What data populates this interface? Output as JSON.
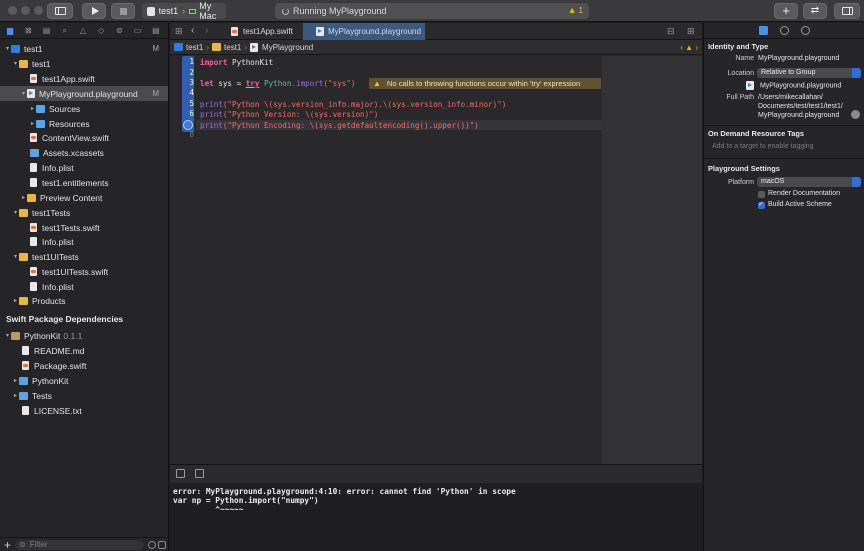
{
  "toolbar": {
    "scheme_target": "test1",
    "scheme_device": "My Mac",
    "activity_status": "Running MyPlayground",
    "warning_count": "1",
    "add_label": "+",
    "review_label": "⇄"
  },
  "navigator": {
    "tree": [
      {
        "label": "test1",
        "icon": "project-icon",
        "badge": "M",
        "disc": "▾"
      },
      {
        "label": "test1",
        "icon": "folder-icon",
        "badge": "",
        "disc": "▾"
      },
      {
        "label": "test1App.swift",
        "icon": "swift-file-icon",
        "badge": "",
        "disc": ""
      },
      {
        "label": "MyPlayground.playground",
        "icon": "playground-icon",
        "badge": "M",
        "disc": "▾",
        "selected": true
      },
      {
        "label": "Sources",
        "icon": "folder-icon",
        "badge": "",
        "disc": "▸"
      },
      {
        "label": "Resources",
        "icon": "folder-icon",
        "badge": "",
        "disc": "▸"
      },
      {
        "label": "ContentView.swift",
        "icon": "swift-file-icon",
        "badge": "",
        "disc": ""
      },
      {
        "label": "Assets.xcassets",
        "icon": "assets-icon",
        "badge": "",
        "disc": ""
      },
      {
        "label": "Info.plist",
        "icon": "plist-icon",
        "badge": "",
        "disc": ""
      },
      {
        "label": "test1.entitlements",
        "icon": "entitlements-icon",
        "badge": "",
        "disc": ""
      },
      {
        "label": "Preview Content",
        "icon": "folder-icon",
        "badge": "",
        "disc": "▸"
      },
      {
        "label": "test1Tests",
        "icon": "folder-icon",
        "badge": "",
        "disc": "▾"
      },
      {
        "label": "test1Tests.swift",
        "icon": "swift-file-icon",
        "badge": "",
        "disc": ""
      },
      {
        "label": "Info.plist",
        "icon": "plist-icon",
        "badge": "",
        "disc": ""
      },
      {
        "label": "test1UITests",
        "icon": "folder-icon",
        "badge": "",
        "disc": "▾"
      },
      {
        "label": "test1UITests.swift",
        "icon": "swift-file-icon",
        "badge": "",
        "disc": ""
      },
      {
        "label": "Info.plist",
        "icon": "plist-icon",
        "badge": "",
        "disc": ""
      },
      {
        "label": "Products",
        "icon": "folder-icon",
        "badge": "",
        "disc": "▸"
      }
    ],
    "section_header": "Swift Package Dependencies",
    "packages": [
      {
        "label": "PythonKit",
        "version": "0.1.1",
        "icon": "package-icon",
        "disc": "▾"
      },
      {
        "label": "README.md",
        "icon": "doc-icon",
        "disc": ""
      },
      {
        "label": "Package.swift",
        "icon": "swift-file-icon",
        "disc": ""
      },
      {
        "label": "PythonKit",
        "icon": "folder-icon",
        "disc": "▸"
      },
      {
        "label": "Tests",
        "icon": "folder-icon",
        "disc": "▸"
      },
      {
        "label": "LICENSE.txt",
        "icon": "doc-icon",
        "disc": ""
      }
    ],
    "filter_placeholder": "Filter"
  },
  "editor": {
    "tabs": [
      {
        "label": "test1App.swift",
        "active": false
      },
      {
        "label": "MyPlayground.playground",
        "active": true
      }
    ],
    "breadcrumb": [
      "test1",
      "test1",
      "MyPlayground"
    ],
    "line_numbers": [
      "1",
      "2",
      "3",
      "4",
      "5",
      "6",
      "7",
      "8"
    ],
    "code": {
      "line1_kw": "import",
      "line1_rest": " PythonKit",
      "line3_kw1": "let",
      "line3_mid": " sys = ",
      "line3_kw2": "try",
      "line3_typ": " Python",
      "line3_fn": ".import",
      "line3_str": "(\"sys\")",
      "line5_fn": "print",
      "line5_str": "(\"Python \\(sys.version_info.major).\\(sys.version_info.minor)\")",
      "line6_fn": "print",
      "line6_str": "(\"Python Version: \\(sys.version)\")",
      "line7_fn": "print",
      "line7_str": "(\"Python Encoding: \\(sys.getdefaultencoding().upper())\")"
    },
    "warning_text": "No calls to throwing functions occur within 'try' expression",
    "console_lines": [
      "error: MyPlayground.playground:4:10: error: cannot find 'Python' in scope",
      "var np = Python.import(\"numpy\")",
      "         ^~~~~~"
    ]
  },
  "inspector": {
    "identity_header": "Identity and Type",
    "name_label": "Name",
    "name_value": "MyPlayground.playground",
    "location_label": "Location",
    "location_value": "Relative to Group",
    "location_file": "MyPlayground.playground",
    "fullpath_label": "Full Path",
    "fullpath_value": "/Users/mikecallahan/\nDocuments/test/test1/test1/\nMyPlayground.playground",
    "ondemand_header": "On Demand Resource Tags",
    "tags_placeholder": "Add to a target to enable tagging",
    "playground_header": "Playground Settings",
    "platform_label": "Platform",
    "platform_value": "macOS",
    "render_docs_label": "Render Documentation",
    "build_active_label": "Build Active Scheme"
  },
  "colors": {
    "accent": "#2f6fd8",
    "keyword": "#fc5fa3",
    "string": "#fc6a5d",
    "warning": "#5e5233"
  }
}
